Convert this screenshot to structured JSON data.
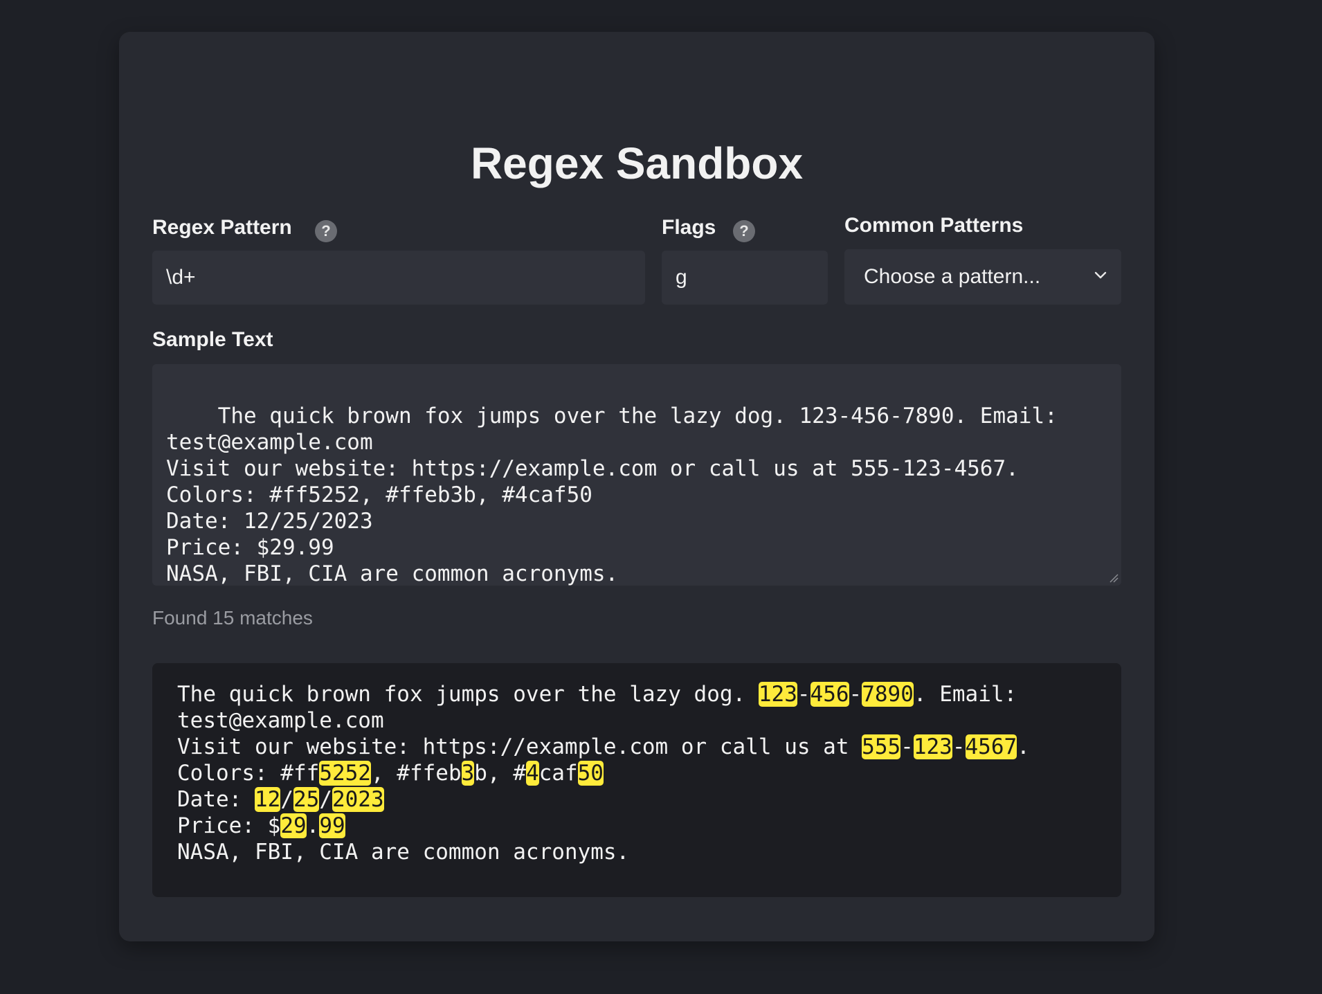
{
  "app": {
    "title": "Regex Sandbox"
  },
  "pattern": {
    "label": "Regex Pattern",
    "help": "?",
    "value": "\\d+"
  },
  "flags": {
    "label": "Flags",
    "help": "?",
    "value": "g"
  },
  "common_patterns": {
    "label": "Common Patterns",
    "selected": "Choose a pattern..."
  },
  "sample": {
    "label": "Sample Text",
    "text": "The quick brown fox jumps over the lazy dog. 123-456-7890. Email:\ntest@example.com\nVisit our website: https://example.com or call us at 555-123-4567.\nColors: #ff5252, #ffeb3b, #4caf50\nDate: 12/25/2023\nPrice: $29.99\nNASA, FBI, CIA are common acronyms."
  },
  "status": {
    "text": "Found 15 matches"
  },
  "result": {
    "lines": [
      [
        {
          "t": "The quick brown fox jumps over the lazy dog. "
        },
        {
          "t": "123",
          "m": true
        },
        {
          "t": "-"
        },
        {
          "t": "456",
          "m": true
        },
        {
          "t": "-"
        },
        {
          "t": "7890",
          "m": true
        },
        {
          "t": ". Email:"
        }
      ],
      [
        {
          "t": "test@example.com"
        }
      ],
      [
        {
          "t": "Visit our website: https://example.com or call us at "
        },
        {
          "t": "555",
          "m": true
        },
        {
          "t": "-"
        },
        {
          "t": "123",
          "m": true
        },
        {
          "t": "-"
        },
        {
          "t": "4567",
          "m": true
        },
        {
          "t": "."
        }
      ],
      [
        {
          "t": "Colors: #ff"
        },
        {
          "t": "5252",
          "m": true
        },
        {
          "t": ", #ffeb"
        },
        {
          "t": "3",
          "m": true
        },
        {
          "t": "b, #"
        },
        {
          "t": "4",
          "m": true
        },
        {
          "t": "caf"
        },
        {
          "t": "50",
          "m": true
        }
      ],
      [
        {
          "t": "Date: "
        },
        {
          "t": "12",
          "m": true
        },
        {
          "t": "/"
        },
        {
          "t": "25",
          "m": true
        },
        {
          "t": "/"
        },
        {
          "t": "2023",
          "m": true
        }
      ],
      [
        {
          "t": "Price: $"
        },
        {
          "t": "29",
          "m": true
        },
        {
          "t": "."
        },
        {
          "t": "99",
          "m": true
        }
      ],
      [
        {
          "t": "NASA, FBI, CIA are common acronyms."
        }
      ]
    ],
    "highlight_color": "#ffeb3b"
  },
  "icons": {
    "help": "help-circle-icon",
    "dropdown": "chevron-down-icon",
    "resize": "resize-handle-icon"
  }
}
